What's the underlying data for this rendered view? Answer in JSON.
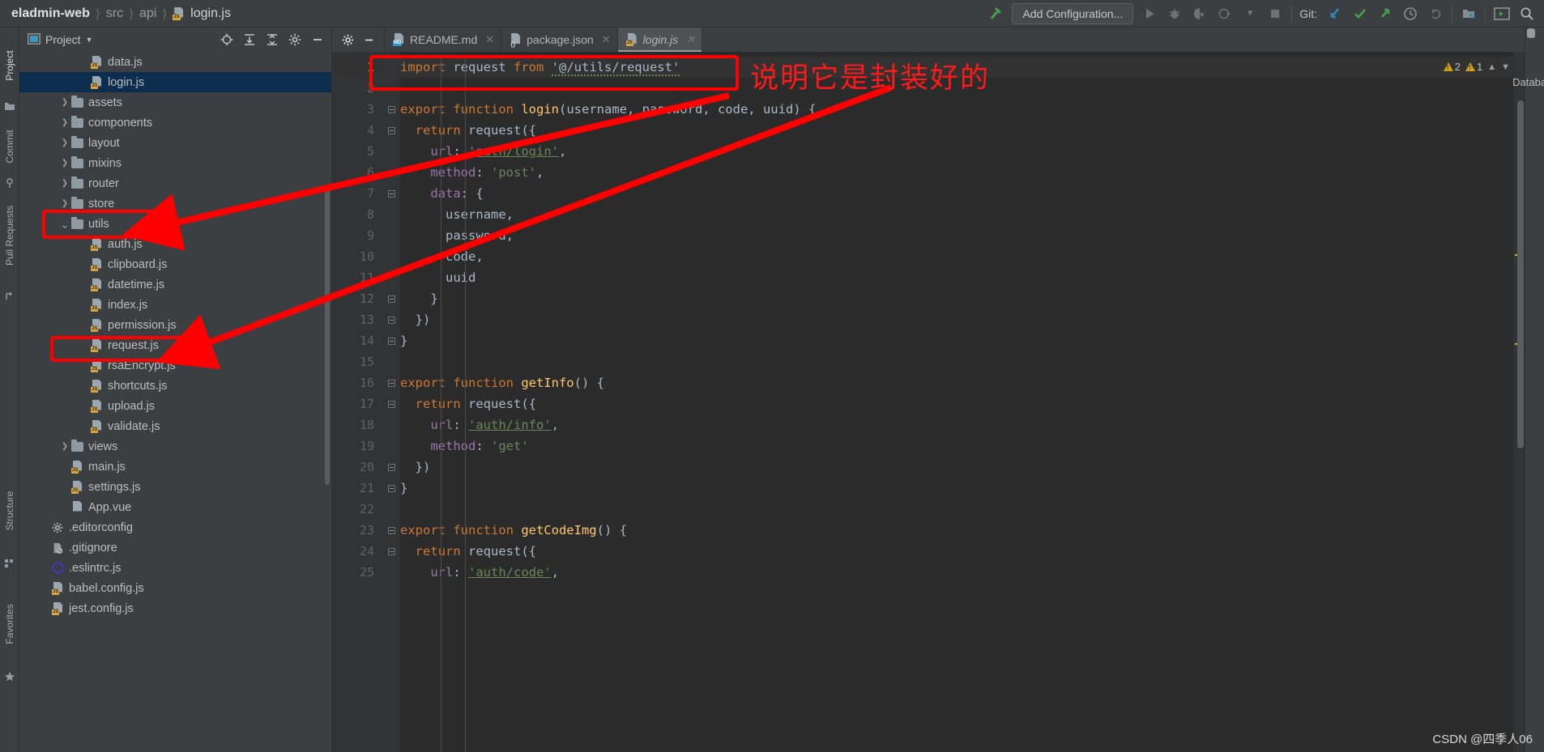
{
  "window": {
    "breadcrumb": [
      "eladmin-web",
      "src",
      "api",
      "login.js"
    ],
    "add_configuration": "Add Configuration...",
    "git_label": "Git:"
  },
  "left_rail": [
    {
      "label": "Project",
      "selected": true
    },
    {
      "label": "Commit",
      "selected": false
    },
    {
      "label": "Pull Requests",
      "selected": false
    },
    {
      "label": "Structure",
      "selected": false
    },
    {
      "label": "Favorites",
      "selected": false
    }
  ],
  "right_rail": [
    {
      "label": "Database"
    }
  ],
  "project_panel": {
    "title": "Project",
    "tree": [
      {
        "label": "data.js",
        "indent": 3,
        "type": "js",
        "arrow": "",
        "selected": false
      },
      {
        "label": "login.js",
        "indent": 3,
        "type": "js",
        "arrow": "",
        "selected": true
      },
      {
        "label": "assets",
        "indent": 2,
        "type": "folder",
        "arrow": "›",
        "selected": false
      },
      {
        "label": "components",
        "indent": 2,
        "type": "folder",
        "arrow": "›",
        "selected": false
      },
      {
        "label": "layout",
        "indent": 2,
        "type": "folder",
        "arrow": "›",
        "selected": false
      },
      {
        "label": "mixins",
        "indent": 2,
        "type": "folder",
        "arrow": "›",
        "selected": false
      },
      {
        "label": "router",
        "indent": 2,
        "type": "folder",
        "arrow": "›",
        "selected": false
      },
      {
        "label": "store",
        "indent": 2,
        "type": "folder",
        "arrow": "›",
        "selected": false
      },
      {
        "label": "utils",
        "indent": 2,
        "type": "folder",
        "arrow": "⌄",
        "selected": false
      },
      {
        "label": "auth.js",
        "indent": 3,
        "type": "js",
        "arrow": "",
        "selected": false
      },
      {
        "label": "clipboard.js",
        "indent": 3,
        "type": "js",
        "arrow": "",
        "selected": false
      },
      {
        "label": "datetime.js",
        "indent": 3,
        "type": "js",
        "arrow": "",
        "selected": false
      },
      {
        "label": "index.js",
        "indent": 3,
        "type": "js",
        "arrow": "",
        "selected": false
      },
      {
        "label": "permission.js",
        "indent": 3,
        "type": "js",
        "arrow": "",
        "selected": false
      },
      {
        "label": "request.js",
        "indent": 3,
        "type": "js",
        "arrow": "",
        "selected": false
      },
      {
        "label": "rsaEncrypt.js",
        "indent": 3,
        "type": "js",
        "arrow": "",
        "selected": false
      },
      {
        "label": "shortcuts.js",
        "indent": 3,
        "type": "js",
        "arrow": "",
        "selected": false
      },
      {
        "label": "upload.js",
        "indent": 3,
        "type": "js",
        "arrow": "",
        "selected": false
      },
      {
        "label": "validate.js",
        "indent": 3,
        "type": "js",
        "arrow": "",
        "selected": false
      },
      {
        "label": "views",
        "indent": 2,
        "type": "folder",
        "arrow": "›",
        "selected": false
      },
      {
        "label": "main.js",
        "indent": 2,
        "type": "js",
        "arrow": "",
        "selected": false
      },
      {
        "label": "settings.js",
        "indent": 2,
        "type": "js",
        "arrow": "",
        "selected": false
      },
      {
        "label": "App.vue",
        "indent": 2,
        "type": "vue",
        "arrow": "",
        "selected": false
      },
      {
        "label": ".editorconfig",
        "indent": 1,
        "type": "gear",
        "arrow": "",
        "selected": false
      },
      {
        "label": ".gitignore",
        "indent": 1,
        "type": "ignore",
        "arrow": "",
        "selected": false
      },
      {
        "label": ".eslintrc.js",
        "indent": 1,
        "type": "eslint",
        "arrow": "",
        "selected": false
      },
      {
        "label": "babel.config.js",
        "indent": 1,
        "type": "js",
        "arrow": "",
        "selected": false
      },
      {
        "label": "jest.config.js",
        "indent": 1,
        "type": "js",
        "arrow": "",
        "selected": false
      }
    ]
  },
  "editor": {
    "tabs": [
      {
        "label": "README.md",
        "type": "md",
        "active": false
      },
      {
        "label": "package.json",
        "type": "json",
        "active": false
      },
      {
        "label": "login.js",
        "type": "js",
        "active": true
      }
    ],
    "inspections": {
      "warnings": "2",
      "weak_warnings": "1"
    },
    "line_numbers": [
      "1",
      "2",
      "3",
      "4",
      "5",
      "6",
      "7",
      "8",
      "9",
      "10",
      "11",
      "12",
      "13",
      "14",
      "15",
      "16",
      "17",
      "18",
      "19",
      "20",
      "21",
      "22",
      "23",
      "24",
      "25"
    ],
    "code_lines": [
      {
        "n": 1,
        "tokens": [
          {
            "t": "import ",
            "c": "kw"
          },
          {
            "t": "request ",
            "c": "pl"
          },
          {
            "t": "from ",
            "c": "kw"
          },
          {
            "t": "'@/utils/request'",
            "c": "squig"
          }
        ]
      },
      {
        "n": 2,
        "tokens": []
      },
      {
        "n": 3,
        "tokens": [
          {
            "t": "export function ",
            "c": "kw"
          },
          {
            "t": "login",
            "c": "fn"
          },
          {
            "t": "(",
            "c": "pl"
          },
          {
            "t": "username, password, code, uuid",
            "c": "pl"
          },
          {
            "t": ") {",
            "c": "pl"
          }
        ]
      },
      {
        "n": 4,
        "tokens": [
          {
            "t": "  ",
            "c": "pl"
          },
          {
            "t": "return ",
            "c": "kw"
          },
          {
            "t": "request({",
            "c": "pl"
          }
        ]
      },
      {
        "n": 5,
        "tokens": [
          {
            "t": "    ",
            "c": "pl"
          },
          {
            "t": "url",
            "c": "prop"
          },
          {
            "t": ": ",
            "c": "pl"
          },
          {
            "t": "'auth/login'",
            "c": "strlink"
          },
          {
            "t": ",",
            "c": "pl"
          }
        ]
      },
      {
        "n": 6,
        "tokens": [
          {
            "t": "    ",
            "c": "pl"
          },
          {
            "t": "method",
            "c": "prop"
          },
          {
            "t": ": ",
            "c": "pl"
          },
          {
            "t": "'post'",
            "c": "str"
          },
          {
            "t": ",",
            "c": "pl"
          }
        ]
      },
      {
        "n": 7,
        "tokens": [
          {
            "t": "    ",
            "c": "pl"
          },
          {
            "t": "data",
            "c": "prop"
          },
          {
            "t": ": {",
            "c": "pl"
          }
        ]
      },
      {
        "n": 8,
        "tokens": [
          {
            "t": "      username,",
            "c": "pl"
          }
        ]
      },
      {
        "n": 9,
        "tokens": [
          {
            "t": "      password,",
            "c": "pl"
          }
        ]
      },
      {
        "n": 10,
        "tokens": [
          {
            "t": "      code,",
            "c": "pl"
          }
        ]
      },
      {
        "n": 11,
        "tokens": [
          {
            "t": "      uuid",
            "c": "pl"
          }
        ]
      },
      {
        "n": 12,
        "tokens": [
          {
            "t": "    }",
            "c": "pl"
          }
        ]
      },
      {
        "n": 13,
        "tokens": [
          {
            "t": "  })",
            "c": "pl"
          }
        ]
      },
      {
        "n": 14,
        "tokens": [
          {
            "t": "}",
            "c": "pl"
          }
        ]
      },
      {
        "n": 15,
        "tokens": []
      },
      {
        "n": 16,
        "tokens": [
          {
            "t": "export function ",
            "c": "kw"
          },
          {
            "t": "getInfo",
            "c": "fn"
          },
          {
            "t": "() {",
            "c": "pl"
          }
        ]
      },
      {
        "n": 17,
        "tokens": [
          {
            "t": "  ",
            "c": "pl"
          },
          {
            "t": "return ",
            "c": "kw"
          },
          {
            "t": "request({",
            "c": "pl"
          }
        ]
      },
      {
        "n": 18,
        "tokens": [
          {
            "t": "    ",
            "c": "pl"
          },
          {
            "t": "url",
            "c": "prop"
          },
          {
            "t": ": ",
            "c": "pl"
          },
          {
            "t": "'auth/info'",
            "c": "strlink"
          },
          {
            "t": ",",
            "c": "pl"
          }
        ]
      },
      {
        "n": 19,
        "tokens": [
          {
            "t": "    ",
            "c": "pl"
          },
          {
            "t": "method",
            "c": "prop"
          },
          {
            "t": ": ",
            "c": "pl"
          },
          {
            "t": "'get'",
            "c": "str"
          }
        ]
      },
      {
        "n": 20,
        "tokens": [
          {
            "t": "  })",
            "c": "pl"
          }
        ]
      },
      {
        "n": 21,
        "tokens": [
          {
            "t": "}",
            "c": "pl"
          }
        ]
      },
      {
        "n": 22,
        "tokens": []
      },
      {
        "n": 23,
        "tokens": [
          {
            "t": "export function ",
            "c": "kw"
          },
          {
            "t": "getCodeImg",
            "c": "fn"
          },
          {
            "t": "() {",
            "c": "pl"
          }
        ]
      },
      {
        "n": 24,
        "tokens": [
          {
            "t": "  ",
            "c": "pl"
          },
          {
            "t": "return ",
            "c": "kw"
          },
          {
            "t": "request({",
            "c": "pl"
          }
        ]
      },
      {
        "n": 25,
        "tokens": [
          {
            "t": "    ",
            "c": "pl"
          },
          {
            "t": "url",
            "c": "prop"
          },
          {
            "t": ": ",
            "c": "pl"
          },
          {
            "t": "'auth/code'",
            "c": "strlink"
          },
          {
            "t": ",",
            "c": "pl"
          }
        ]
      }
    ]
  },
  "annotations": {
    "note_text": "说明它是封装好的",
    "accent_color": "#ff0000",
    "highlighted": [
      "utils",
      "request.js",
      "import request from '@/utils/request'"
    ]
  },
  "watermark": "CSDN @四季人06"
}
